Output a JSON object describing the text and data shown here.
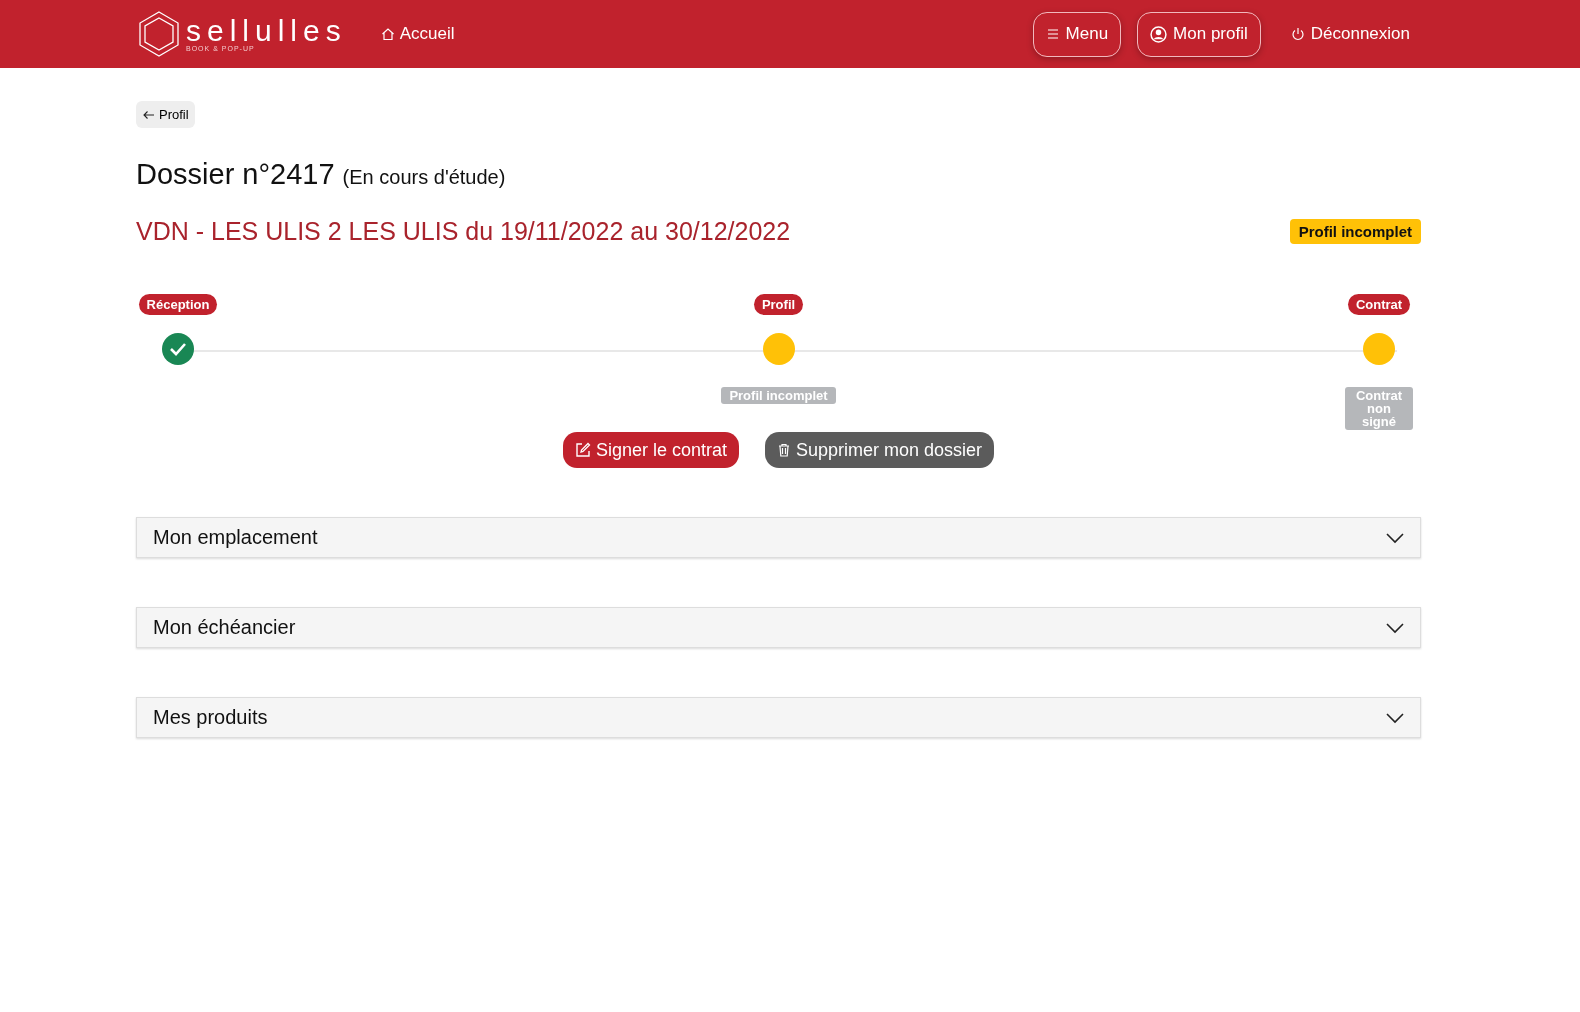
{
  "header": {
    "logo": {
      "name": "sellulles",
      "tagline": "BOOK & POP-UP"
    },
    "home_link": "Accueil",
    "buttons": [
      {
        "kind": "menu",
        "label": "Menu"
      },
      {
        "kind": "profile",
        "label": "Mon profil"
      }
    ],
    "logout": "Déconnexion"
  },
  "back_link": "Profil",
  "title": {
    "main": "Dossier n°2417",
    "status": "(En cours d'étude)"
  },
  "event": "VDN - LES ULIS 2 LES ULIS du 19/11/2022 au 30/12/2022",
  "badge": "Profil incomplet",
  "steps": [
    {
      "label": "Réception",
      "completed": true
    },
    {
      "label": "Profil",
      "completed": false,
      "note": "Profil incomplet"
    },
    {
      "label": "Contrat",
      "completed": false,
      "note": "Contrat non signé"
    }
  ],
  "actions": [
    {
      "kind": "sign",
      "label": "Signer le contrat"
    },
    {
      "kind": "delete",
      "label": "Supprimer mon dossier"
    }
  ],
  "sections": [
    {
      "title": "Mon emplacement",
      "expanded": false
    },
    {
      "title": "Mon échéancier",
      "expanded": false
    },
    {
      "title": "Mes produits",
      "expanded": false
    }
  ]
}
